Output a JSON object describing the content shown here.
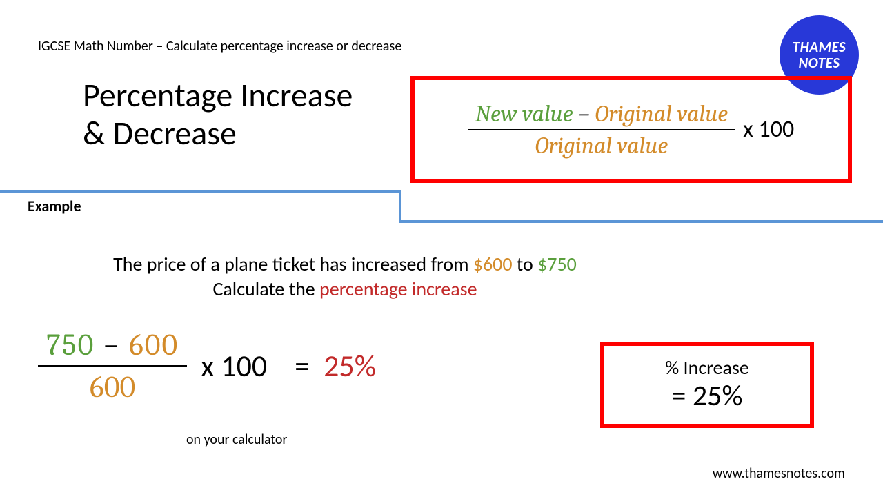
{
  "breadcrumb": "IGCSE Math Number – Calculate percentage increase or decrease",
  "logo": {
    "line1": "THAMES",
    "line2": "NOTES"
  },
  "title": {
    "line1": "Percentage Increase",
    "line2": "& Decrease"
  },
  "formula": {
    "new_value": "New value",
    "minus": " − ",
    "original_value": "Original value",
    "denom": "Original value",
    "times": "x 100"
  },
  "example_label": "Example",
  "question": {
    "pre": "The price of a plane ticket has increased from ",
    "from": "$600",
    "mid": " to ",
    "to": "$750",
    "line2_pre": "Calculate the ",
    "line2_red": "percentage increase"
  },
  "calc": {
    "num_a": "750",
    "num_minus": "  −  ",
    "num_b": "600",
    "denom": "600",
    "times": "x 100",
    "eq": "=",
    "result": "25%",
    "note": "on your calculator"
  },
  "answer": {
    "label": "% Increase",
    "value": "= 25%"
  },
  "footer": "www.thamesnotes.com",
  "colors": {
    "accent_blue": "#5b95d6",
    "logo_blue": "#2838d8",
    "red": "#ff0000",
    "text_red": "#c22a2a",
    "green": "#5a9f3c",
    "orange": "#d38b2a"
  }
}
